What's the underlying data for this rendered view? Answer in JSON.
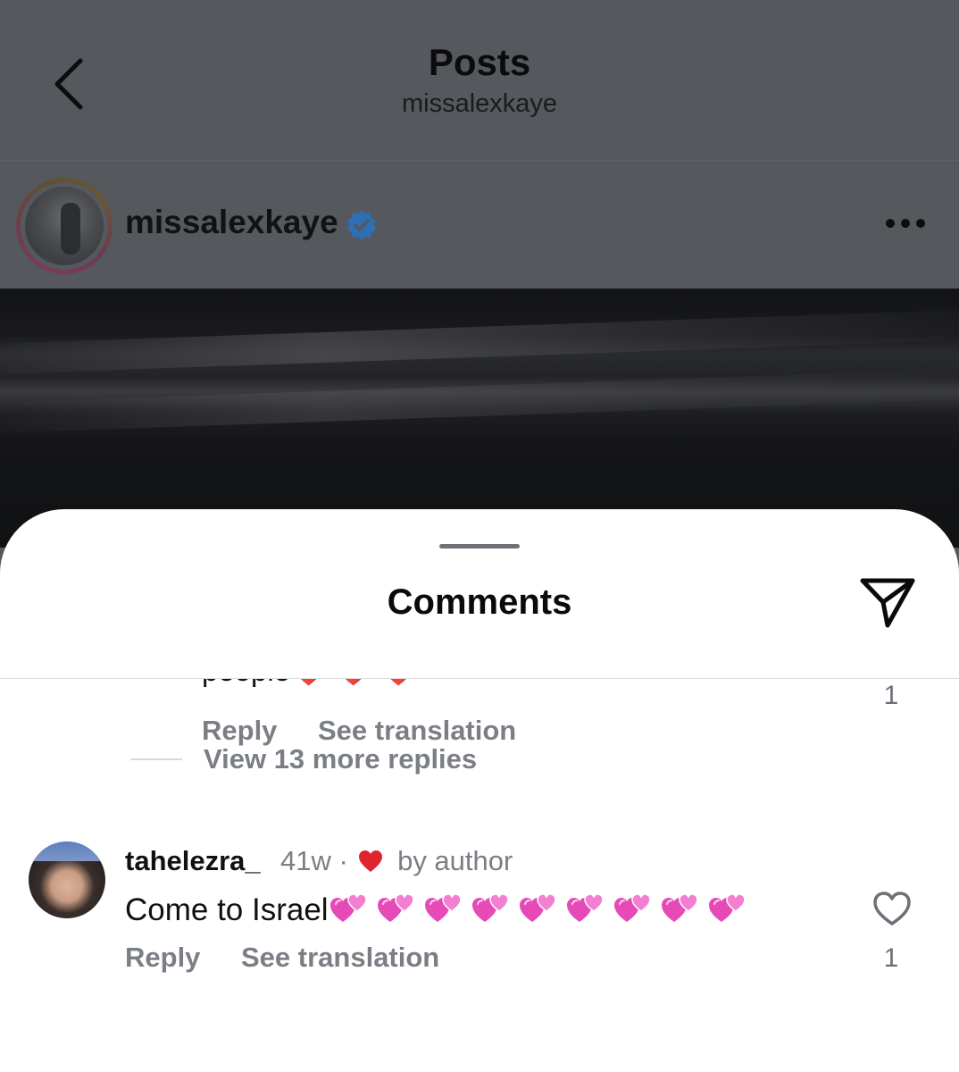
{
  "header": {
    "title": "Posts",
    "subtitle": "missalexkaye",
    "back_icon": "chevron-left-icon"
  },
  "post": {
    "username": "missalexkaye",
    "verified_icon": "verified-badge-icon",
    "more_icon": "more-horizontal-icon"
  },
  "comments_sheet": {
    "title": "Comments",
    "share_icon": "paper-plane-icon",
    "previous_comment": {
      "text_tail": "people",
      "emoji": "❤️ ❤️ ❤️",
      "like_count": "1",
      "reply_label": "Reply",
      "translate_label": "See translation"
    },
    "view_replies_label": "View 13 more replies",
    "comment": {
      "username": "tahelezra_",
      "time": "41w",
      "separator": "·",
      "liked_by_label": "by author",
      "text": "Come to Israel",
      "emoji_count": 9,
      "like_count": "1",
      "reply_label": "Reply",
      "translate_label": "See translation",
      "like_icon": "heart-outline-icon"
    }
  },
  "colors": {
    "overlay_bg": "#55585c",
    "secondary_text": "#7b7f85",
    "accent_red": "#e0242d",
    "verified_blue": "#2f6fb3",
    "pink_heart": "#e64ab7"
  }
}
